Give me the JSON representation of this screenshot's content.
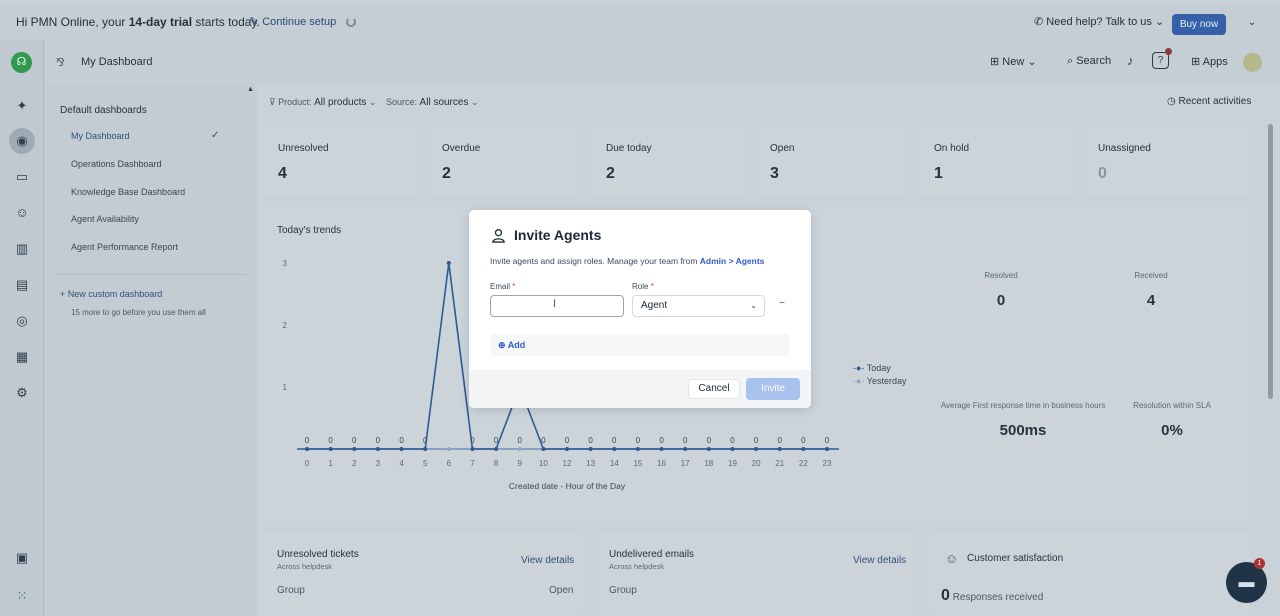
{
  "trial": {
    "prefix": "Hi PMN Online, your ",
    "bold": "14-day trial",
    "suffix": " starts today.",
    "setup": "Continue setup",
    "help": "Need help? Talk to us",
    "buy": "Buy now"
  },
  "topbar": {
    "title": "My Dashboard",
    "new": "New",
    "search": "Search",
    "apps": "Apps",
    "help_glyph": "?"
  },
  "dashboards": {
    "heading": "Default dashboards",
    "items": [
      "My Dashboard",
      "Operations Dashboard",
      "Knowledge Base Dashboard",
      "Agent Availability",
      "Agent Performance Report"
    ],
    "new_custom": "+ New custom dashboard",
    "more": "15 more to go before you use them all"
  },
  "filters": {
    "product_label": "Product:",
    "product_value": "All products",
    "source_label": "Source:",
    "source_value": "All sources",
    "recent": "Recent activities"
  },
  "summary": [
    {
      "label": "Unresolved",
      "value": "4"
    },
    {
      "label": "Overdue",
      "value": "2"
    },
    {
      "label": "Due today",
      "value": "2"
    },
    {
      "label": "Open",
      "value": "3"
    },
    {
      "label": "On hold",
      "value": "1"
    },
    {
      "label": "Unassigned",
      "value": "0"
    }
  ],
  "trends": {
    "title": "Today's trends",
    "stats": [
      {
        "label": "Resolved",
        "value": "0"
      },
      {
        "label": "Received",
        "value": "4"
      },
      {
        "label": "Average First response time in business hours",
        "value": "500ms"
      },
      {
        "label": "Resolution within SLA",
        "value": "0%"
      }
    ]
  },
  "chart_data": {
    "type": "line",
    "title": "Today's trends",
    "xlabel": "Created date - Hour of the Day",
    "ylabel": "",
    "categories": [
      "0",
      "1",
      "2",
      "3",
      "4",
      "5",
      "6",
      "7",
      "8",
      "9",
      "10",
      "12",
      "13",
      "14",
      "15",
      "16",
      "17",
      "18",
      "19",
      "20",
      "21",
      "22",
      "23"
    ],
    "y_ticks": [
      "1",
      "2",
      "3"
    ],
    "ylim": [
      0,
      3
    ],
    "series": [
      {
        "name": "Today",
        "values": [
          0,
          0,
          0,
          0,
          0,
          0,
          3,
          0,
          0,
          1,
          0,
          0,
          0,
          0,
          0,
          0,
          0,
          0,
          0,
          0,
          0,
          0,
          0
        ]
      },
      {
        "name": "Yesterday",
        "values": [
          0,
          0,
          0,
          0,
          0,
          0,
          0,
          0,
          0,
          0,
          0,
          0,
          0,
          0,
          0,
          0,
          0,
          0,
          0,
          0,
          0,
          0,
          0
        ]
      }
    ],
    "data_labels": [
      "0",
      "0",
      "0",
      "0",
      "0",
      "0",
      "",
      "0",
      "0",
      "0",
      "0",
      "0",
      "0",
      "0",
      "0",
      "0",
      "0",
      "0",
      "0",
      "0",
      "0",
      "0",
      "0"
    ],
    "legend": "right"
  },
  "bottom": {
    "unresolved_title": "Unresolved tickets",
    "unresolved_sub": "Across helpdesk",
    "undelivered_title": "Undelivered emails",
    "undelivered_sub": "Across helpdesk",
    "view_details": "View details",
    "group": "Group",
    "open": "Open",
    "csat_title": "Customer satisfaction",
    "csat_count": "0",
    "csat_text": "Responses received"
  },
  "chat_badge": "1",
  "modal": {
    "title": "Invite Agents",
    "desc": "Invite agents and assign roles. Manage your team from ",
    "desc_link": "Admin > Agents",
    "email_label": "Email",
    "role_label": "Role",
    "email_value": "",
    "role_value": "Agent",
    "add": "Add",
    "cancel": "Cancel",
    "invite": "Invite"
  }
}
